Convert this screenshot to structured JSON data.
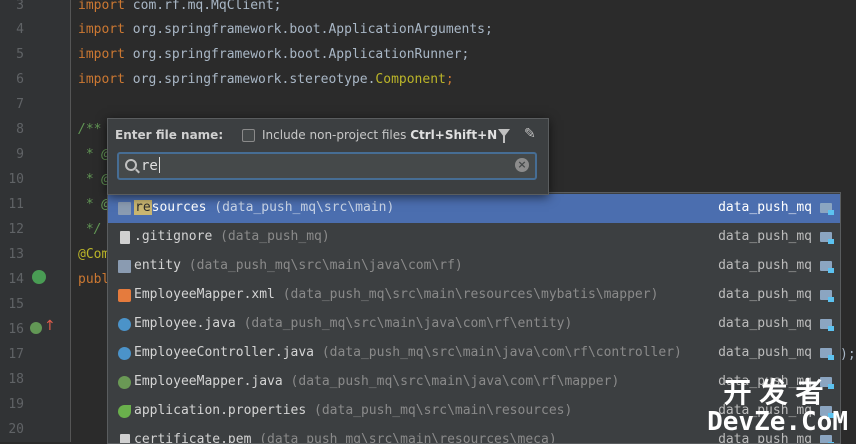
{
  "editor": {
    "line_numbers": [
      "3",
      "4",
      "5",
      "6",
      "7",
      "8",
      "9",
      "10",
      "11",
      "12",
      "13",
      "14",
      "15",
      "16",
      "17",
      "18",
      "19",
      "20"
    ],
    "lines": {
      "l3": {
        "kw": "import",
        "rest": " com.rf.mq.MqClient;"
      },
      "l4": {
        "kw": "import",
        "rest": " org.springframework.boot.ApplicationArguments;"
      },
      "l5": {
        "kw": "import",
        "rest": " org.springframework.boot.ApplicationRunner;"
      },
      "l6": {
        "kw": "import",
        "rest": " org.springframework.stereotype.",
        "ann": "Component",
        "end": ";"
      },
      "l8": "/**",
      "l9": " * @",
      "l10": " * @",
      "l11": " * @",
      "l12": " */",
      "l13": "@Com",
      "l14": "publ",
      "l17_tail": ");"
    }
  },
  "dialog": {
    "label": "Enter file name:",
    "checkbox_label": "Include non-project files",
    "shortcut": "Ctrl+Shift+N",
    "search_value": "re",
    "filter_icon": "filter-icon",
    "pin_icon": "pin-icon"
  },
  "results": [
    {
      "icon": "folder-icon",
      "highlight": "re",
      "name": "sources",
      "path": " (data_push_mq\\src\\main)",
      "module": "data_push_mq",
      "selected": true
    },
    {
      "icon": "file-icon",
      "highlight": "",
      "name": ".gitignore",
      "path": " (data_push_mq)",
      "module": "data_push_mq",
      "selected": false
    },
    {
      "icon": "folder-icon",
      "highlight": "",
      "name": "entity",
      "path": " (data_push_mq\\src\\main\\java\\com\\rf)",
      "module": "data_push_mq",
      "selected": false
    },
    {
      "icon": "xml-icon",
      "highlight": "",
      "name": "EmployeeMapper.xml",
      "path": " (data_push_mq\\src\\main\\resources\\mybatis\\mapper)",
      "module": "data_push_mq",
      "selected": false
    },
    {
      "icon": "class-icon",
      "highlight": "",
      "name": "Employee.java",
      "path": " (data_push_mq\\src\\main\\java\\com\\rf\\entity)",
      "module": "data_push_mq",
      "selected": false
    },
    {
      "icon": "class-icon",
      "highlight": "",
      "name": "EmployeeController.java",
      "path": " (data_push_mq\\src\\main\\java\\com\\rf\\controller)",
      "module": "data_push_mq",
      "selected": false
    },
    {
      "icon": "interface-icon",
      "highlight": "",
      "name": "EmployeeMapper.java",
      "path": " (data_push_mq\\src\\main\\java\\com\\rf\\mapper)",
      "module": "data_push_mq",
      "selected": false
    },
    {
      "icon": "properties-icon",
      "highlight": "",
      "name": "application.properties",
      "path": " (data_push_mq\\src\\main\\resources)",
      "module": "data_push_mq",
      "selected": false
    },
    {
      "icon": "file-icon",
      "highlight": "",
      "name": "certificate.pem",
      "path": " (data_push_mq\\src\\main\\resources\\meca)",
      "module": "data_push_mq",
      "selected": false
    }
  ],
  "watermark": {
    "top": "开发者",
    "bottom": "DevZe.CoM"
  },
  "colors": {
    "selection": "#4b6eaf",
    "keyword": "#cc7832",
    "annotation": "#bbb529",
    "comment": "#629755"
  }
}
